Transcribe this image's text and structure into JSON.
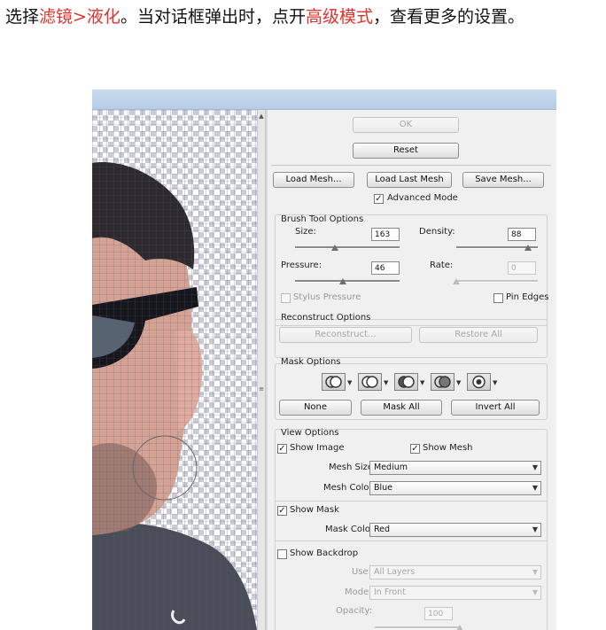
{
  "instruction": {
    "part1": "选择",
    "part2": "滤镜>液化",
    "part3": "。当对话框弹出时，点开",
    "part4": "高级模式",
    "part5": "，查看更多的设置。"
  },
  "buttons": {
    "ok": "OK",
    "reset": "Reset",
    "load_mesh": "Load Mesh...",
    "load_last_mesh": "Load Last Mesh",
    "save_mesh": "Save Mesh..."
  },
  "advanced_mode": {
    "label": "Advanced Mode",
    "checked": true
  },
  "brush_tool_options": {
    "title": "Brush Tool Options",
    "size_label": "Size:",
    "size_value": "163",
    "density_label": "Density:",
    "density_value": "88",
    "pressure_label": "Pressure:",
    "pressure_value": "46",
    "rate_label": "Rate:",
    "rate_value": "0",
    "stylus_pressure_label": "Stylus Pressure",
    "pin_edges_label": "Pin Edges"
  },
  "reconstruct_options": {
    "title": "Reconstruct Options",
    "reconstruct_button": "Reconstruct...",
    "restore_all_button": "Restore All"
  },
  "mask_options": {
    "title": "Mask Options",
    "none_button": "None",
    "mask_all_button": "Mask All",
    "invert_all_button": "Invert All",
    "mode_icons": [
      "replace-selection-icon",
      "add-to-selection-icon",
      "subtract-from-selection-icon",
      "intersect-selection-icon",
      "invert-selection-icon"
    ]
  },
  "view_options": {
    "title": "View Options",
    "show_image_label": "Show Image",
    "show_mesh_label": "Show Mesh",
    "mesh_size_label": "Mesh Size:",
    "mesh_size_value": "Medium",
    "mesh_color_label": "Mesh Color:",
    "mesh_color_value": "Blue",
    "show_mask_label": "Show Mask",
    "mask_color_label": "Mask Color:",
    "mask_color_value": "Red",
    "show_backdrop_label": "Show Backdrop",
    "use_label": "Use:",
    "use_value": "All Layers",
    "mode_label": "Mode:",
    "mode_value": "In Front",
    "opacity_label": "Opacity:",
    "opacity_value": "100"
  },
  "sliders": {
    "size_level": 0.38,
    "density_level": 0.88,
    "pressure_level": 0.46,
    "rate_level": 0.0,
    "opacity_level": 1.0
  },
  "colors": {
    "highlight": "#e0312c",
    "mesh": "#4b4bd6"
  }
}
